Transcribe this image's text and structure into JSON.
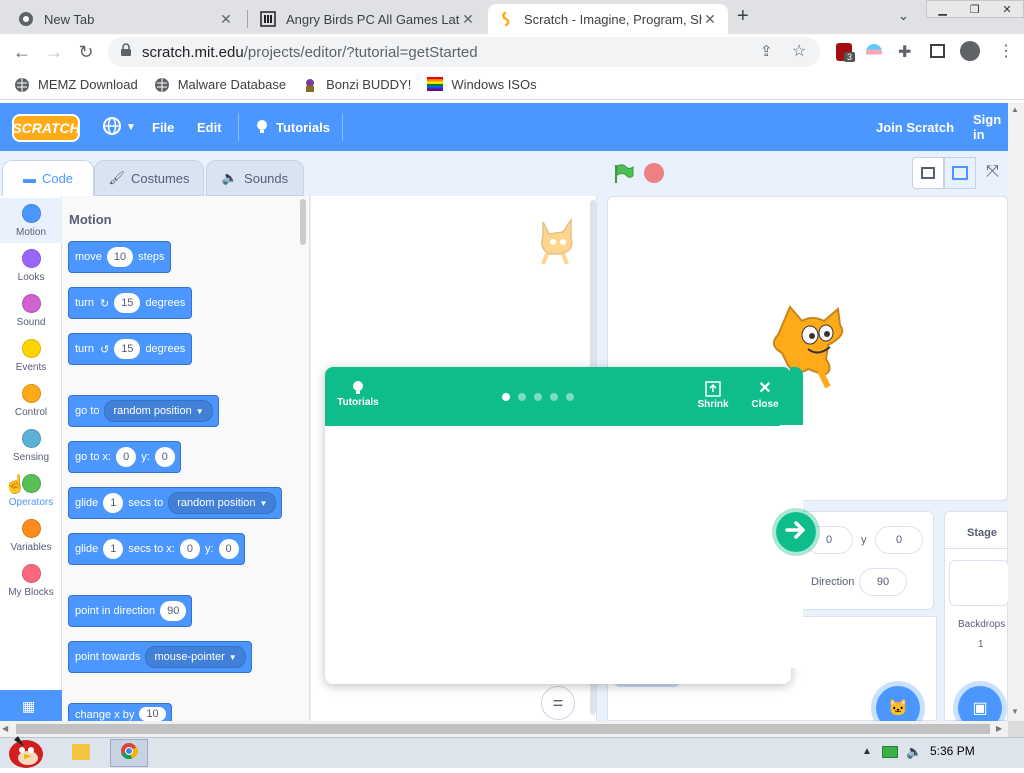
{
  "browser": {
    "tabs": [
      {
        "title": "New Tab",
        "icon": "chrome-icon"
      },
      {
        "title": "Angry Birds PC All Games Late",
        "icon": "museum-icon"
      },
      {
        "title": "Scratch - Imagine, Program, Sh",
        "icon": "scratch-icon"
      }
    ],
    "address": {
      "host": "scratch.mit.edu",
      "path": "/projects/editor/?tutorial=getStarted"
    },
    "extension_badge": "3",
    "bookmarks": [
      "MEMZ Download",
      "Malware Database",
      "Bonzi BUDDY!",
      "Windows ISOs"
    ]
  },
  "scratch": {
    "logo": "SCRATCH",
    "menu": {
      "file": "File",
      "edit": "Edit",
      "tutorials": "Tutorials",
      "join": "Join Scratch",
      "signin": "Sign in"
    },
    "editor_tabs": [
      "Code",
      "Costumes",
      "Sounds"
    ],
    "categories": [
      {
        "label": "Motion",
        "color": "#4c97ff"
      },
      {
        "label": "Looks",
        "color": "#9966ff"
      },
      {
        "label": "Sound",
        "color": "#cf63cf"
      },
      {
        "label": "Events",
        "color": "#ffd500"
      },
      {
        "label": "Control",
        "color": "#ffab19"
      },
      {
        "label": "Sensing",
        "color": "#5cb1d6"
      },
      {
        "label": "Operators",
        "color": "#59c059"
      },
      {
        "label": "Variables",
        "color": "#ff8c1a"
      },
      {
        "label": "My Blocks",
        "color": "#ff6680"
      }
    ],
    "palette_title": "Motion",
    "blocks": {
      "move": {
        "a": "move",
        "v": "10",
        "b": "steps"
      },
      "turn_right": {
        "a": "turn",
        "v": "15",
        "b": "degrees"
      },
      "turn_left": {
        "a": "turn",
        "v": "15",
        "b": "degrees"
      },
      "goto": {
        "a": "go to",
        "dd": "random position"
      },
      "gotoxy": {
        "a": "go to x:",
        "x": "0",
        "b": "y:",
        "y": "0"
      },
      "glide_to": {
        "a": "glide",
        "v": "1",
        "b": "secs to",
        "dd": "random position"
      },
      "glide_xy": {
        "a": "glide",
        "v": "1",
        "b": "secs to x:",
        "x": "0",
        "c": "y:",
        "y": "0"
      },
      "point_dir": {
        "a": "point in direction",
        "v": "90"
      },
      "point_towards": {
        "a": "point towards",
        "dd": "mouse-pointer"
      },
      "change_x": {
        "a": "change x by",
        "v": "10"
      }
    },
    "sprite_info": {
      "x": "0",
      "y_label": "y",
      "y": "0",
      "direction_label": "Direction",
      "direction": "90"
    },
    "stage_panel": {
      "title": "Stage",
      "backdrops_label": "Backdrops",
      "backdrops_count": "1"
    },
    "zoom_reset": "="
  },
  "tutorial": {
    "label": "Tutorials",
    "shrink": "Shrink",
    "close": "Close",
    "steps": 5,
    "current": 1
  },
  "taskbar": {
    "time": "5:36 PM"
  },
  "colors": {
    "scratch_blue": "#4c97ff",
    "tutorial_green": "#0fbd8c"
  }
}
